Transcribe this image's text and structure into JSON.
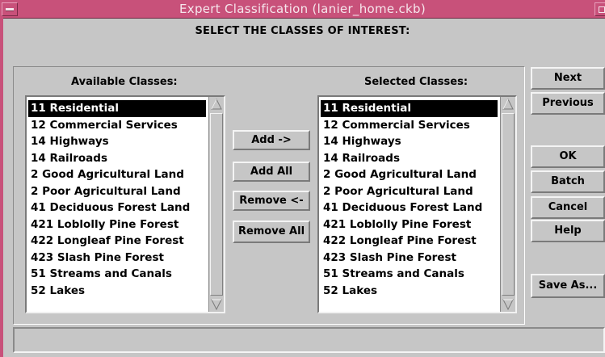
{
  "window": {
    "title": "Expert Classification (lanier_home.ckb)"
  },
  "instruction": "SELECT THE CLASSES OF INTEREST:",
  "available": {
    "label": "Available Classes:",
    "items": [
      "11 Residential",
      "12 Commercial Services",
      "14 Highways",
      "14 Railroads",
      "2 Good Agricultural Land",
      "2 Poor Agricultural Land",
      "41 Deciduous Forest Land",
      "421 Loblolly Pine Forest",
      "422 Longleaf Pine Forest",
      "423 Slash Pine Forest",
      "51 Streams and Canals",
      "52 Lakes"
    ],
    "selected_index": 0
  },
  "selected": {
    "label": "Selected Classes:",
    "items": [
      "11 Residential",
      "12 Commercial Services",
      "14 Highways",
      "14 Railroads",
      "2 Good Agricultural Land",
      "2 Poor Agricultural Land",
      "41 Deciduous Forest Land",
      "421 Loblolly Pine Forest",
      "422 Longleaf Pine Forest",
      "423 Slash Pine Forest",
      "51 Streams and Canals",
      "52 Lakes"
    ],
    "selected_index": 0
  },
  "transfer_buttons": {
    "add": "Add ->",
    "add_all": "Add All",
    "remove": "Remove <-",
    "remove_all": "Remove All"
  },
  "side_buttons": {
    "next": "Next",
    "previous": "Previous",
    "ok": "OK",
    "batch": "Batch",
    "cancel": "Cancel",
    "help": "Help",
    "save_as": "Save As..."
  },
  "status_text": "",
  "icons": {
    "system_menu": "minus-bar-icon",
    "maximize": "square-icon",
    "scroll_up": "triangle-up-icon",
    "scroll_down": "triangle-down-icon"
  },
  "colors": {
    "titlebar": "#c8517a",
    "background": "#c6c6c6",
    "selection": "#000000"
  }
}
